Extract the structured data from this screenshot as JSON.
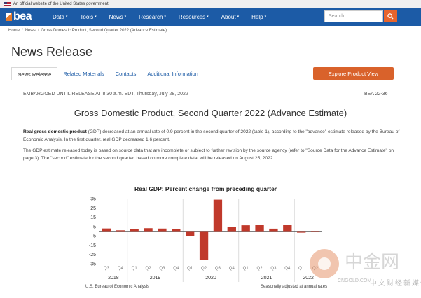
{
  "gov_banner": {
    "text": "An official website of the United States government"
  },
  "brand": {
    "logo_text": "bea"
  },
  "nav": {
    "items": [
      {
        "label": "Data"
      },
      {
        "label": "Tools"
      },
      {
        "label": "News"
      },
      {
        "label": "Research"
      },
      {
        "label": "Resources"
      },
      {
        "label": "About"
      },
      {
        "label": "Help"
      }
    ],
    "search_placeholder": "Search"
  },
  "breadcrumb": [
    "Home",
    "News",
    "Gross Domestic Product, Second Quarter 2022 (Advance Estimate)"
  ],
  "page_title": "News Release",
  "tabs": [
    {
      "label": "News Release",
      "active": true
    },
    {
      "label": "Related Materials",
      "active": false
    },
    {
      "label": "Contacts",
      "active": false
    },
    {
      "label": "Additional Information",
      "active": false
    }
  ],
  "explore_button": "Explore Product View",
  "embargo": "EMBARGOED UNTIL RELEASE AT 8:30 a.m. EDT, Thursday, July 28, 2022",
  "release_id": "BEA 22-36",
  "release_title": "Gross Domestic Product, Second Quarter 2022 (Advance Estimate)",
  "paragraph1": {
    "bold": "Real gross domestic product",
    "text": " (GDP) decreased at an annual rate of 0.9 percent in the second quarter of 2022 (table 1), according to the \"advance\" estimate released by the Bureau of Economic Analysis. In the first quarter, real GDP decreased 1.6 percent."
  },
  "paragraph2": "The GDP estimate released today is based on source data that are incomplete or subject to further revision by the source agency (refer to \"Source Data for the Advance Estimate\" on page 3). The \"second\" estimate for the second quarter, based on more complete data, will be released on August 25, 2022.",
  "source_note": "U.S. Bureau of Economic Analysis",
  "seasonal_note": "Seasonally adjusted at annual rates",
  "watermark": {
    "cn": "中金网",
    "domain": "CNGOLD.COM",
    "sub": "中文财经新媒体"
  },
  "colors": {
    "nav": "#1c5ba6",
    "accent": "#d9622b",
    "bar": "#c0392b"
  },
  "chart_data": {
    "type": "bar",
    "title": "Real GDP:  Percent change from preceding quarter",
    "categories": [
      "Q3",
      "Q4",
      "Q1",
      "Q2",
      "Q3",
      "Q4",
      "Q1",
      "Q2",
      "Q3",
      "Q4",
      "Q1",
      "Q2",
      "Q3",
      "Q4",
      "Q1",
      "Q2"
    ],
    "years": [
      {
        "label": "2018",
        "span": [
          0,
          1
        ]
      },
      {
        "label": "2019",
        "span": [
          2,
          5
        ]
      },
      {
        "label": "2020",
        "span": [
          6,
          9
        ]
      },
      {
        "label": "2021",
        "span": [
          10,
          13
        ]
      },
      {
        "label": "2022",
        "span": [
          14,
          15
        ]
      }
    ],
    "values": [
      2.9,
      0.9,
      2.4,
      3.2,
      2.8,
      1.9,
      -5.1,
      -31.2,
      33.8,
      4.5,
      6.3,
      7.0,
      2.7,
      7.0,
      -1.6,
      -0.9
    ],
    "ylim": [
      -35,
      35
    ],
    "yticks": [
      35,
      25,
      15,
      5,
      -5,
      -15,
      -25,
      -35
    ],
    "grid": true,
    "legend": "none"
  }
}
